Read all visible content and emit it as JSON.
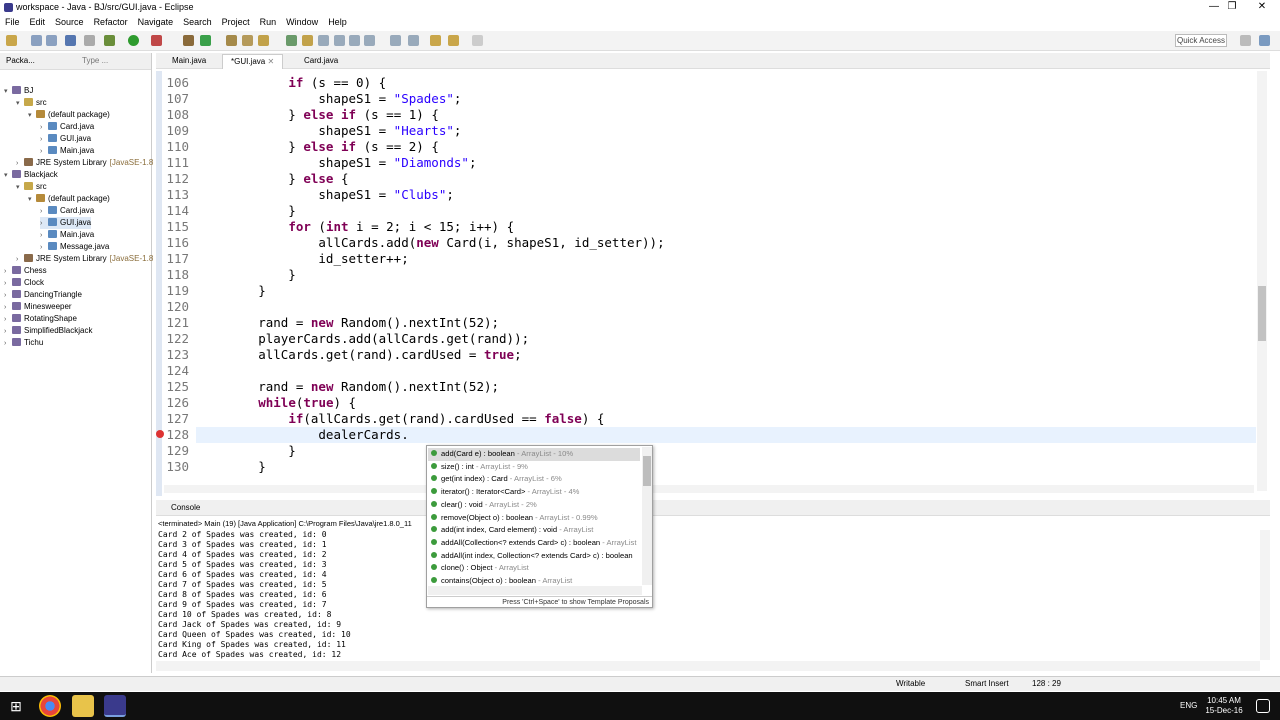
{
  "window": {
    "title": "workspace - Java - BJ/src/GUI.java - Eclipse"
  },
  "menu": [
    "File",
    "Edit",
    "Source",
    "Refactor",
    "Navigate",
    "Search",
    "Project",
    "Run",
    "Window",
    "Help"
  ],
  "toolbar": {
    "quick_access": "Quick Access"
  },
  "package_explorer": {
    "tab1": "Packa...",
    "tab2": "Type ...",
    "items": [
      {
        "label": "BJ",
        "depth": 0,
        "twisty": "▾",
        "kind": "project"
      },
      {
        "label": "src",
        "depth": 1,
        "twisty": "▾",
        "kind": "folder"
      },
      {
        "label": "(default package)",
        "depth": 2,
        "twisty": "▾",
        "kind": "package"
      },
      {
        "label": "Card.java",
        "depth": 3,
        "twisty": "›",
        "kind": "java"
      },
      {
        "label": "GUI.java",
        "depth": 3,
        "twisty": "›",
        "kind": "java"
      },
      {
        "label": "Main.java",
        "depth": 3,
        "twisty": "›",
        "kind": "java"
      },
      {
        "label": "JRE System Library",
        "suffix": "[JavaSE-1.8",
        "depth": 1,
        "twisty": "›",
        "kind": "lib"
      },
      {
        "label": "Blackjack",
        "depth": 0,
        "twisty": "▾",
        "kind": "project"
      },
      {
        "label": "src",
        "depth": 1,
        "twisty": "▾",
        "kind": "folder"
      },
      {
        "label": "(default package)",
        "depth": 2,
        "twisty": "▾",
        "kind": "package"
      },
      {
        "label": "Card.java",
        "depth": 3,
        "twisty": "›",
        "kind": "java"
      },
      {
        "label": "GUI.java",
        "depth": 3,
        "twisty": "›",
        "kind": "java",
        "selected": true
      },
      {
        "label": "Main.java",
        "depth": 3,
        "twisty": "›",
        "kind": "java"
      },
      {
        "label": "Message.java",
        "depth": 3,
        "twisty": "›",
        "kind": "java"
      },
      {
        "label": "JRE System Library",
        "suffix": "[JavaSE-1.8",
        "depth": 1,
        "twisty": "›",
        "kind": "lib"
      },
      {
        "label": "Chess",
        "depth": 0,
        "twisty": "›",
        "kind": "project"
      },
      {
        "label": "Clock",
        "depth": 0,
        "twisty": "›",
        "kind": "project"
      },
      {
        "label": "DancingTriangle",
        "depth": 0,
        "twisty": "›",
        "kind": "project"
      },
      {
        "label": "Minesweeper",
        "depth": 0,
        "twisty": "›",
        "kind": "project"
      },
      {
        "label": "RotatingShape",
        "depth": 0,
        "twisty": "›",
        "kind": "project"
      },
      {
        "label": "SimplifiedBlackjack",
        "depth": 0,
        "twisty": "›",
        "kind": "project"
      },
      {
        "label": "Tichu",
        "depth": 0,
        "twisty": "›",
        "kind": "project"
      }
    ]
  },
  "editor": {
    "tabs": [
      {
        "label": "Main.java",
        "active": false
      },
      {
        "label": "*GUI.java",
        "active": true
      },
      {
        "label": "Card.java",
        "active": false
      }
    ],
    "lines": [
      {
        "n": "106",
        "code": "            if (s == 0) {"
      },
      {
        "n": "107",
        "code": "                shapeS1 = \"Spades\";"
      },
      {
        "n": "108",
        "code": "            } else if (s == 1) {"
      },
      {
        "n": "109",
        "code": "                shapeS1 = \"Hearts\";"
      },
      {
        "n": "110",
        "code": "            } else if (s == 2) {"
      },
      {
        "n": "111",
        "code": "                shapeS1 = \"Diamonds\";"
      },
      {
        "n": "112",
        "code": "            } else {"
      },
      {
        "n": "113",
        "code": "                shapeS1 = \"Clubs\";"
      },
      {
        "n": "114",
        "code": "            }"
      },
      {
        "n": "115",
        "code": "            for (int i = 2; i < 15; i++) {"
      },
      {
        "n": "116",
        "code": "                allCards.add(new Card(i, shapeS1, id_setter));"
      },
      {
        "n": "117",
        "code": "                id_setter++;"
      },
      {
        "n": "118",
        "code": "            }"
      },
      {
        "n": "119",
        "code": "        }"
      },
      {
        "n": "120",
        "code": ""
      },
      {
        "n": "121",
        "code": "        rand = new Random().nextInt(52);"
      },
      {
        "n": "122",
        "code": "        playerCards.add(allCards.get(rand));"
      },
      {
        "n": "123",
        "code": "        allCards.get(rand).cardUsed = true;"
      },
      {
        "n": "124",
        "code": ""
      },
      {
        "n": "125",
        "code": "        rand = new Random().nextInt(52);"
      },
      {
        "n": "126",
        "code": "        while(true) {"
      },
      {
        "n": "127",
        "code": "            if(allCards.get(rand).cardUsed == false) {"
      },
      {
        "n": "128",
        "code": "                dealerCards."
      },
      {
        "n": "129",
        "code": "            }"
      },
      {
        "n": "130",
        "code": "        }"
      }
    ]
  },
  "completion": {
    "items": [
      {
        "sig": "add(Card e) : boolean",
        "cls": " - ArrayList - 10%",
        "selected": true
      },
      {
        "sig": "size() : int",
        "cls": " - ArrayList - 9%"
      },
      {
        "sig": "get(int index) : Card",
        "cls": " - ArrayList - 6%"
      },
      {
        "sig": "iterator() : Iterator<Card>",
        "cls": " - ArrayList - 4%"
      },
      {
        "sig": "clear() : void",
        "cls": " - ArrayList - 2%"
      },
      {
        "sig": "remove(Object o) : boolean",
        "cls": " - ArrayList - 0.99%"
      },
      {
        "sig": "add(int index, Card element) : void",
        "cls": " - ArrayList"
      },
      {
        "sig": "addAll(Collection<? extends Card> c) : boolean",
        "cls": " - ArrayList"
      },
      {
        "sig": "addAll(int index, Collection<? extends Card> c) : boolean",
        "cls": ""
      },
      {
        "sig": "clone() : Object",
        "cls": " - ArrayList"
      },
      {
        "sig": "contains(Object o) : boolean",
        "cls": " - ArrayList"
      }
    ],
    "footer": "Press 'Ctrl+Space' to show Template Proposals"
  },
  "console": {
    "tab": "Console",
    "terminated": "<terminated> Main (19) [Java Application] C:\\Program Files\\Java\\jre1.8.0_11",
    "lines": [
      "Card 2 of Spades was created, id: 0",
      "Card 3 of Spades was created, id: 1",
      "Card 4 of Spades was created, id: 2",
      "Card 5 of Spades was created, id: 3",
      "Card 6 of Spades was created, id: 4",
      "Card 7 of Spades was created, id: 5",
      "Card 8 of Spades was created, id: 6",
      "Card 9 of Spades was created, id: 7",
      "Card 10 of Spades was created, id: 8",
      "Card Jack of Spades was created, id: 9",
      "Card Queen of Spades was created, id: 10",
      "Card King of Spades was created, id: 11",
      "Card Ace of Spades was created, id: 12"
    ]
  },
  "status": {
    "writable": "Writable",
    "insert": "Smart Insert",
    "position": "128 : 29"
  },
  "taskbar": {
    "time": "10:45 AM",
    "date": "15-Dec-16",
    "lang": "ENG"
  },
  "colors": {
    "keyword": "#7f0055",
    "string": "#2a00ff",
    "selection": "#e8f2fe"
  }
}
